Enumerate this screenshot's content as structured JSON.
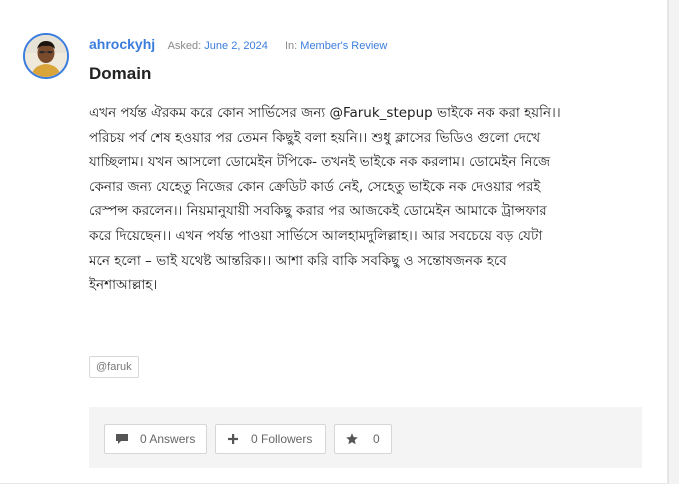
{
  "question": {
    "author": "ahrockyhj",
    "asked_label": "Asked:",
    "asked_date": "June 2, 2024",
    "in_label": "In:",
    "category": "Member's Review",
    "title": "Domain",
    "body_lines": [
      "এখন পর্যন্ত ঐরকম করে কোন সার্ভিসের জন্য @Faruk_stepup ভাইকে নক করা হয়নি।।",
      "পরিচয় পর্ব শেষ হওয়ার পর তেমন কিছুই বলা হয়নি।। শুধু ক্লাসের ভিডিও গুলো দেখে",
      "যাচ্ছিলাম। যখন আসলো ডোমেইন টপিকে- তখনই ভাইকে নক করলাম। ডোমেইন নিজে",
      "কেনার জন্য যেহেতু নিজের কোন ক্রেডিট কার্ড নেই, সেহেতু ভাইকে নক দেওয়ার পরই",
      "রেস্পন্স করলেন।। নিয়মানুযায়ী সবকিছু করার পর আজকেই ডোমেইন আমাকে ট্রান্সফার",
      "করে দিয়েছেন।। এখন পর্যন্ত পাওয়া সার্ভিসে আলহামদুলিল্লাহ।। আর সবচেয়ে বড় যেটা",
      "মনে হলো – ভাই যথেষ্ট আন্তরিক।। আশা করি বাকি সবকিছু ও সন্তোষজনক হবে",
      "ইনশাআল্লাহ।"
    ],
    "tag": "@faruk"
  },
  "actions": {
    "answers_label": "0 Answers",
    "followers_label": "0 Followers",
    "star_count": "0"
  },
  "icons": {
    "answers": "comment-icon",
    "followers": "plus-icon",
    "star": "star-icon"
  },
  "colors": {
    "accent": "#3b7ddd",
    "muted": "#8a8a8a",
    "footer_bg": "#f4f4f4"
  }
}
